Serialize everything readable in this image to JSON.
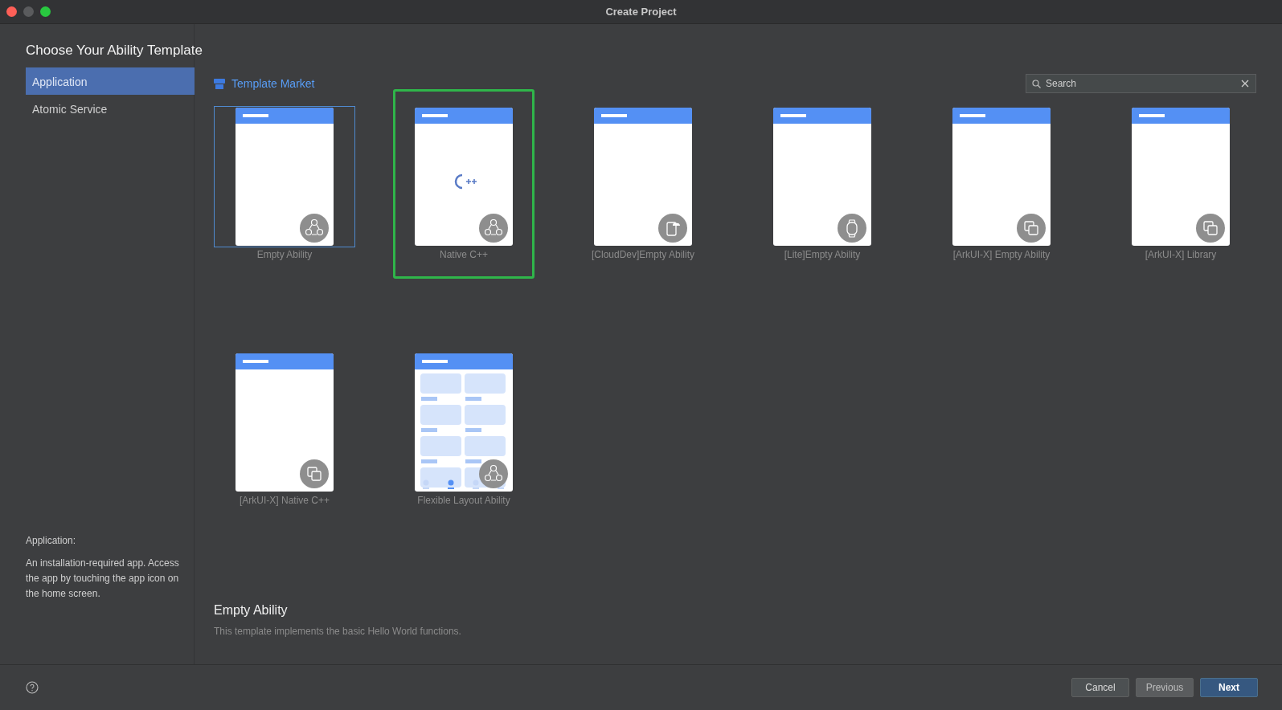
{
  "window": {
    "title": "Create Project"
  },
  "heading": "Choose Your Ability Template",
  "sidebar": {
    "items": [
      {
        "label": "Application",
        "selected": true
      },
      {
        "label": "Atomic Service",
        "selected": false
      }
    ],
    "description_title": "Application:",
    "description": "An installation-required app. Access the app by touching the app icon on the home screen."
  },
  "market": {
    "label": "Template Market"
  },
  "search": {
    "placeholder": "Search"
  },
  "templates": [
    {
      "name": "Empty Ability",
      "selected": true,
      "highlighted": false,
      "preview": {
        "kind": "blank"
      },
      "badge": {
        "kind": "nodes"
      }
    },
    {
      "name": "Native C++",
      "selected": false,
      "highlighted": true,
      "preview": {
        "kind": "cpp"
      },
      "badge": {
        "kind": "nodes"
      }
    },
    {
      "name": "[CloudDev]Empty Ability",
      "selected": false,
      "highlighted": false,
      "preview": {
        "kind": "blank"
      },
      "badge": {
        "kind": "cloud"
      }
    },
    {
      "name": "[Lite]Empty Ability",
      "selected": false,
      "highlighted": false,
      "preview": {
        "kind": "blank"
      },
      "badge": {
        "kind": "watch"
      }
    },
    {
      "name": "[ArkUI-X] Empty Ability",
      "selected": false,
      "highlighted": false,
      "preview": {
        "kind": "blank"
      },
      "badge": {
        "kind": "windows"
      }
    },
    {
      "name": "[ArkUI-X] Library",
      "selected": false,
      "highlighted": false,
      "preview": {
        "kind": "blank"
      },
      "badge": {
        "kind": "windows"
      }
    },
    {
      "name": "[ArkUI-X] Native C++",
      "selected": false,
      "highlighted": false,
      "preview": {
        "kind": "blank"
      },
      "badge": {
        "kind": "windows"
      }
    },
    {
      "name": "Flexible Layout Ability",
      "selected": false,
      "highlighted": false,
      "preview": {
        "kind": "grid"
      },
      "badge": {
        "kind": "nodes"
      }
    }
  ],
  "detail": {
    "title": "Empty Ability",
    "text": "This template implements the basic Hello World functions."
  },
  "buttons": [
    {
      "label": "Cancel",
      "kind": "normal",
      "disabled": false
    },
    {
      "label": "Previous",
      "kind": "normal",
      "disabled": true
    },
    {
      "label": "Next",
      "kind": "primary",
      "disabled": false
    }
  ]
}
